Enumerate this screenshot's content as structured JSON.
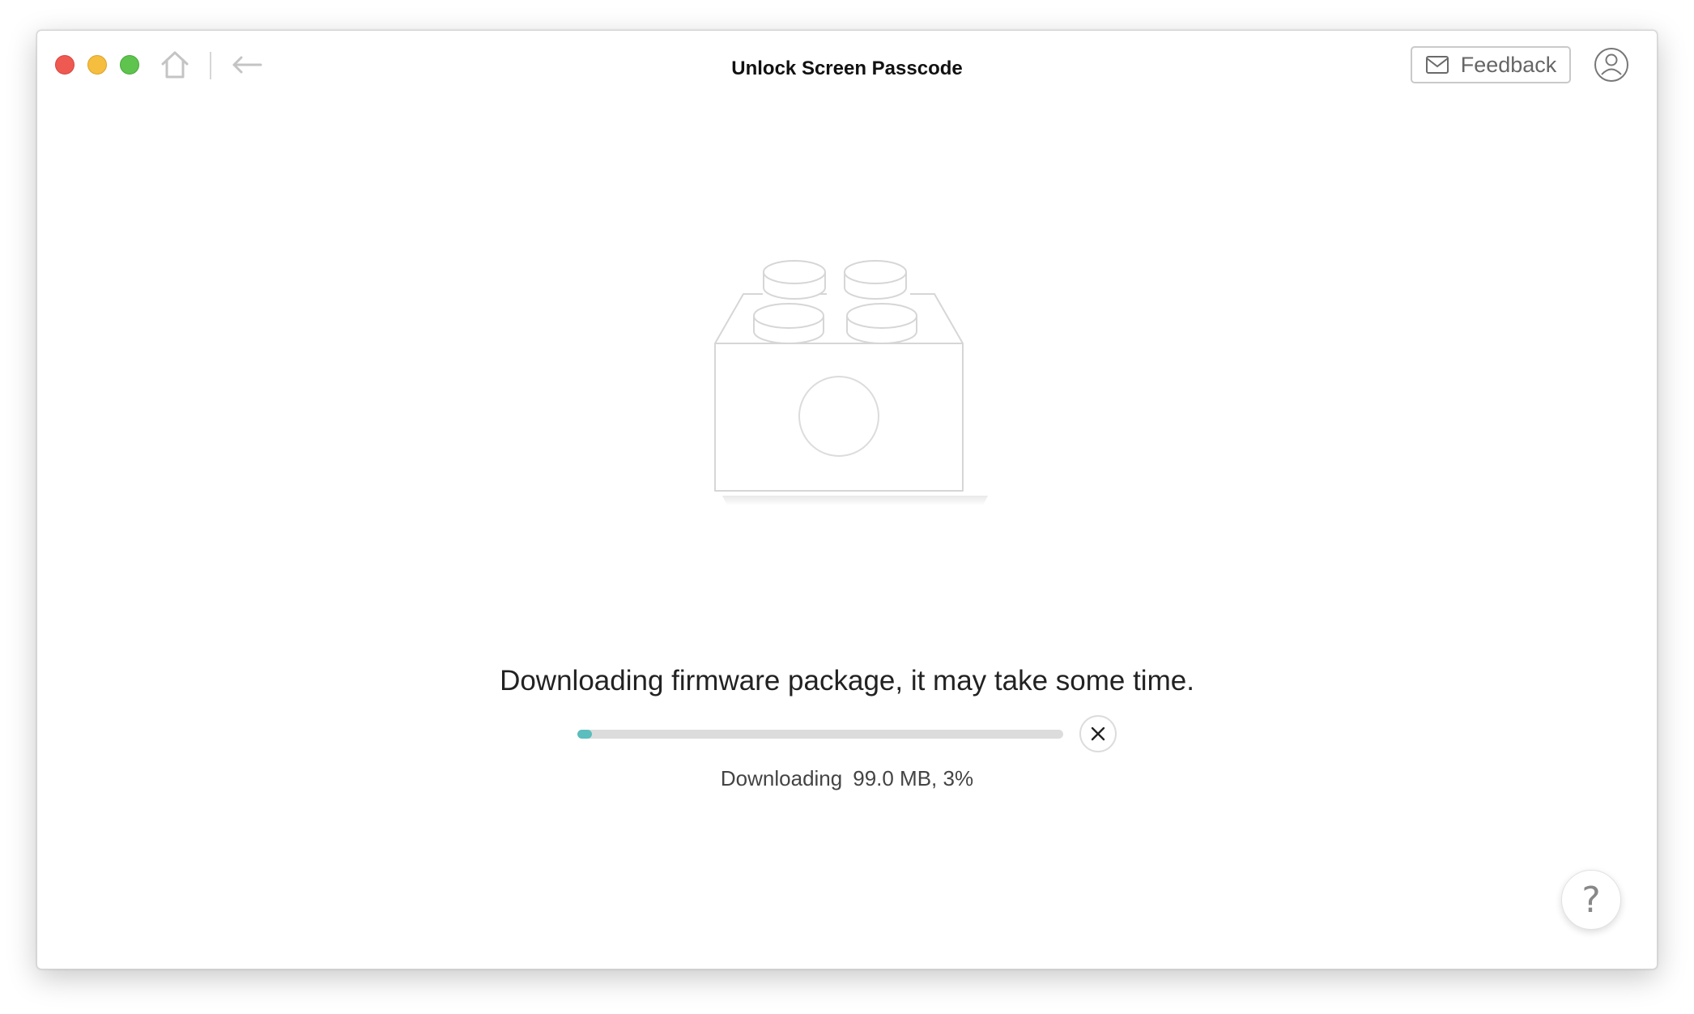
{
  "window": {
    "title": "Unlock Screen Passcode"
  },
  "toolbar": {
    "home_icon": "home-icon",
    "back_icon": "arrow-left-icon",
    "feedback_label": "Feedback",
    "feedback_icon": "mail-icon",
    "account_icon": "user-icon"
  },
  "main": {
    "illustration_icon": "firmware-brick-icon",
    "heading": "Downloading firmware package, it may take some time.",
    "progress": {
      "percent": 3,
      "status_label": "Downloading",
      "status_detail": "99.0 MB, 3%"
    },
    "cancel_icon": "close-icon"
  },
  "help": {
    "label": "?"
  },
  "colors": {
    "close": "#ee5a52",
    "minimize": "#f5be3e",
    "maximize": "#5ec44e",
    "progress_fill": "#5bbdbd",
    "progress_track": "#dcdcdc"
  }
}
